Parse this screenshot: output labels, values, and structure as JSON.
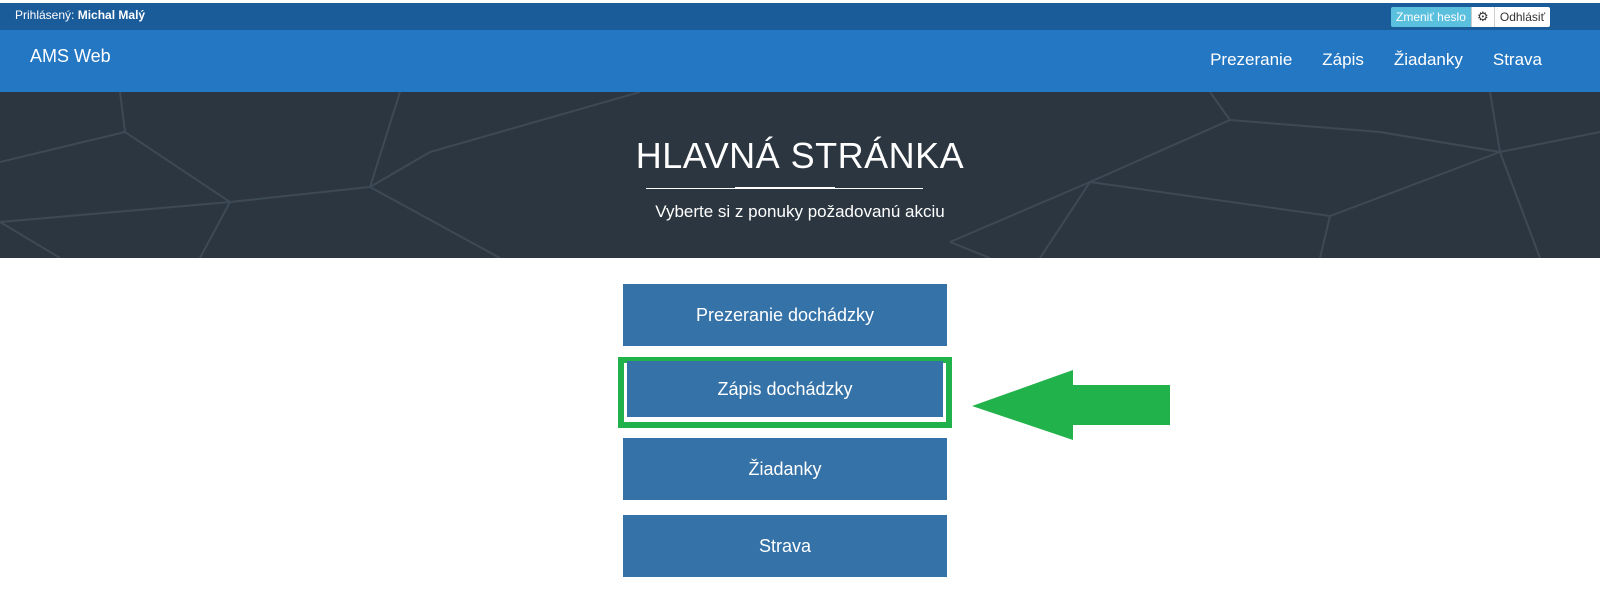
{
  "topbar": {
    "logged_in_label": "Prihlásený:",
    "user_name": "Michal Malý",
    "change_password_label": "Zmeniť heslo",
    "gear_icon": "gear-icon",
    "logout_label": "Odhlásiť"
  },
  "navbar": {
    "brand": "AMS Web",
    "items": [
      {
        "label": "Prezeranie"
      },
      {
        "label": "Zápis"
      },
      {
        "label": "Žiadanky"
      },
      {
        "label": "Strava"
      }
    ]
  },
  "hero": {
    "title": "HLAVNÁ STRÁNKA",
    "subtitle": "Vyberte si z ponuky požadovanú akciu"
  },
  "menu": {
    "buttons": [
      {
        "label": "Prezeranie dochádzky"
      },
      {
        "label": "Zápis dochádzky"
      },
      {
        "label": "Žiadanky"
      },
      {
        "label": "Strava"
      }
    ]
  },
  "annotation": {
    "highlight_color": "#22b24c",
    "arrow_icon": "arrow-left-icon"
  },
  "colors": {
    "topbar": "#1a5b99",
    "navbar": "#2477c2",
    "hero": "#2b3640",
    "button": "#3572a8"
  }
}
